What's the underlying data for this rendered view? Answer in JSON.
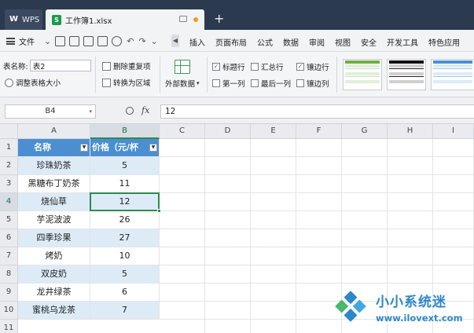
{
  "app": {
    "tabs": [
      {
        "label": "WPS"
      },
      {
        "label": "工作簿1.xlsx"
      }
    ],
    "new_tab": "+"
  },
  "menubar": {
    "file_label": "文件",
    "tabs": [
      "插入",
      "页面布局",
      "公式",
      "数据",
      "审阅",
      "视图",
      "安全",
      "开发工具",
      "特色应用"
    ]
  },
  "ribbon": {
    "table_name_label": "表名称:",
    "table_name_value": "表2",
    "resize_label": "调整表格大小",
    "remove_dup_label": "删除重复项",
    "convert_range_label": "转换为区域",
    "external_data_label": "外部数据",
    "options": [
      {
        "label": "标题行",
        "checked": true
      },
      {
        "label": "汇总行",
        "checked": false
      },
      {
        "label": "镶边行",
        "checked": true
      },
      {
        "label": "第一列",
        "checked": false
      },
      {
        "label": "最后一列",
        "checked": false
      },
      {
        "label": "镶边列",
        "checked": false
      }
    ],
    "check_mark": "✓",
    "accent_colors": {
      "green": "#1c9a48",
      "blue": "#4b8fd1",
      "band": "#ddebf7"
    }
  },
  "formulabar": {
    "cell_ref": "B4",
    "fx": "fx",
    "value": "12"
  },
  "grid": {
    "columns": [
      "A",
      "B",
      "C",
      "D",
      "E",
      "F",
      "G",
      "H",
      "I"
    ],
    "rows": [
      "1",
      "2",
      "3",
      "4",
      "5",
      "6",
      "7",
      "8",
      "9",
      "10",
      "11"
    ],
    "selected_column": "B",
    "selected_row": "4",
    "header": [
      "名称",
      "价格（元/杯"
    ],
    "filter_glyph": "▼",
    "data": [
      [
        "珍珠奶茶",
        "5"
      ],
      [
        "黑糖布丁奶茶",
        "11"
      ],
      [
        "烧仙草",
        "12"
      ],
      [
        "芋泥波波",
        "26"
      ],
      [
        "四季珍果",
        "27"
      ],
      [
        "烤奶",
        "10"
      ],
      [
        "双皮奶",
        "5"
      ],
      [
        "龙井绿茶",
        "6"
      ],
      [
        "蜜桃乌龙茶",
        "7"
      ]
    ]
  },
  "watermark": {
    "title": "小小系统迷",
    "url": "www.ilovext.com"
  }
}
